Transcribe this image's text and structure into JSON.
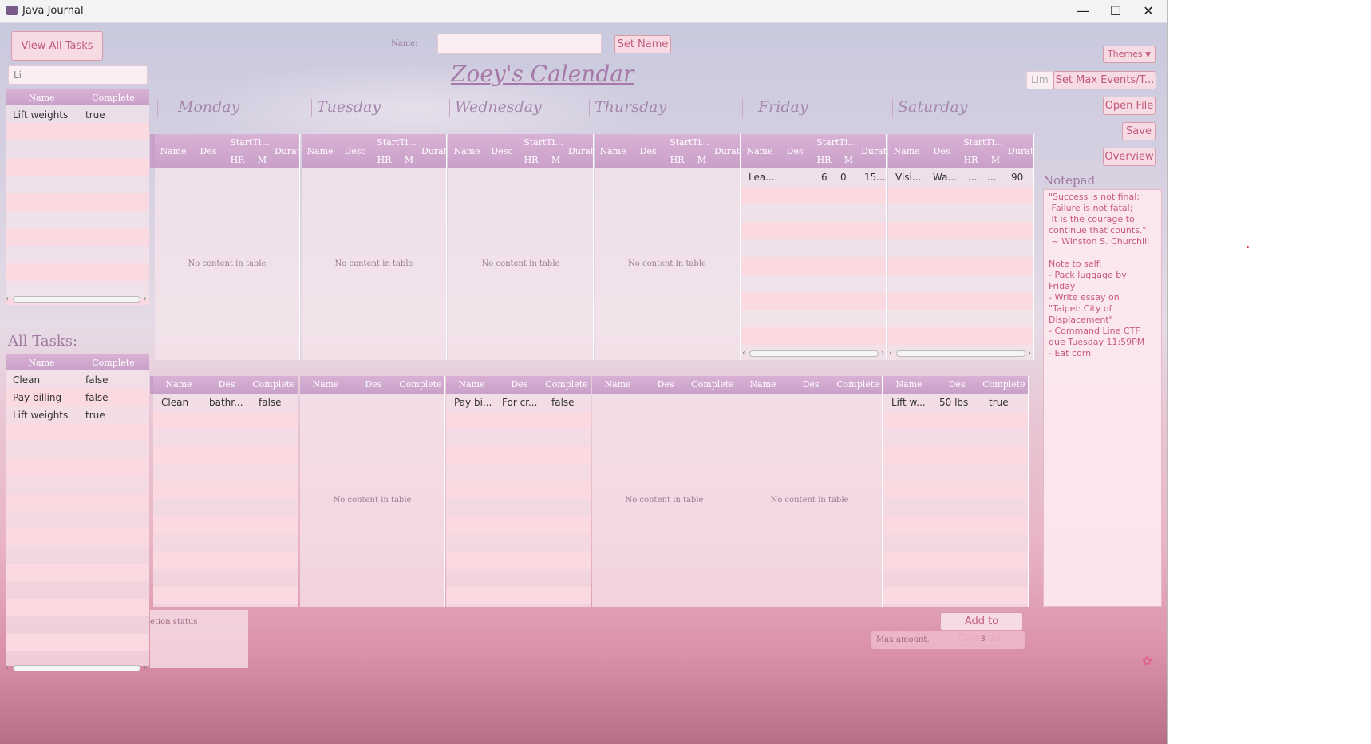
{
  "window": {
    "title": "Java Journal",
    "minimize": "—",
    "maximize": "☐",
    "close": "✕"
  },
  "left": {
    "view_all_button": "View All Tasks",
    "search_value": "Li",
    "filtered_headers": [
      "Name",
      "Complete"
    ],
    "filtered_rows": [
      [
        "Lift weights",
        "true"
      ]
    ],
    "all_tasks_label": "All Tasks:",
    "all_headers": [
      "Name",
      "Complete"
    ],
    "all_rows": [
      [
        "Clean",
        "false"
      ],
      [
        "Pay billing",
        "false"
      ],
      [
        "Lift weights",
        "true"
      ]
    ]
  },
  "top": {
    "name_label": "Name:",
    "name_value": "",
    "set_name_button": "Set Name",
    "calendar_title": "Zoey's Calendar"
  },
  "right": {
    "themes_button": "Themes",
    "lim_label": "Lim",
    "set_max_button": "Set Max Events/T...",
    "open_file_button": "Open File",
    "save_button": "Save",
    "overview_button": "Overview",
    "notepad_label": "Notepad",
    "notepad_text": "\"Success is not final;\n Failure is not fatal;\n It is the courage to\ncontinue that counts.\"\n ~ Winston S. Churchill\n\nNote to self:\n- Pack luggage by\nFriday\n- Write essay on\n\"Taipei: City of\nDisplacement\"\n- Command Line CTF\ndue Tuesday 11:59PM\n- Eat corn"
  },
  "days": [
    "Monday",
    "Tuesday",
    "Wednesday",
    "Thursday",
    "Friday",
    "Saturday"
  ],
  "empty_text": "No content in table",
  "events": {
    "monday": {
      "headers": [
        "Name",
        "Des",
        "StartTi...",
        "HR",
        "M",
        "Durat..."
      ],
      "rows": []
    },
    "tuesday": {
      "headers": [
        "Name",
        "Desc",
        "StartTi...",
        "HR",
        "M",
        "Durat..."
      ],
      "rows": []
    },
    "wednesday": {
      "headers": [
        "Name",
        "Desc",
        "StartTi...",
        "HR",
        "M",
        "Durati"
      ],
      "rows": []
    },
    "thursday": {
      "headers": [
        "Name",
        "Des",
        "StartTi...",
        "HR",
        "M",
        "Durat..."
      ],
      "rows": []
    },
    "friday": {
      "headers": [
        "Name",
        "Des",
        "StartTi...",
        "HR",
        "M",
        "Durat..."
      ],
      "rows": [
        [
          "Lea...",
          "",
          "6",
          "0",
          "15..."
        ]
      ]
    },
    "saturday": {
      "headers": [
        "Name",
        "Des",
        "StartTi...",
        "HR",
        "M",
        "Durat..."
      ],
      "rows": [
        [
          "Visi...",
          "Wa...",
          "...",
          "...",
          "90"
        ]
      ]
    }
  },
  "tasks": {
    "headers": [
      "Name",
      "Des",
      "Complete"
    ],
    "monday": [
      [
        "Clean",
        "bathr...",
        "false"
      ]
    ],
    "tuesday": [],
    "wednesday": [
      [
        "Pay bi...",
        "For cr...",
        "false"
      ]
    ],
    "thursday": [],
    "friday": [],
    "saturday": [
      [
        "Lift w...",
        "50 lbs",
        "true"
      ]
    ]
  },
  "bottom": {
    "completion_label": "etion status",
    "add_calendar_button": "Add to Calendar",
    "max_amount_label": "Max amount:",
    "max_amount_value": "3"
  },
  "colors": {
    "accent": "#c05a78",
    "header": "#c9a0c8",
    "stripe": "#fbd9e1"
  }
}
